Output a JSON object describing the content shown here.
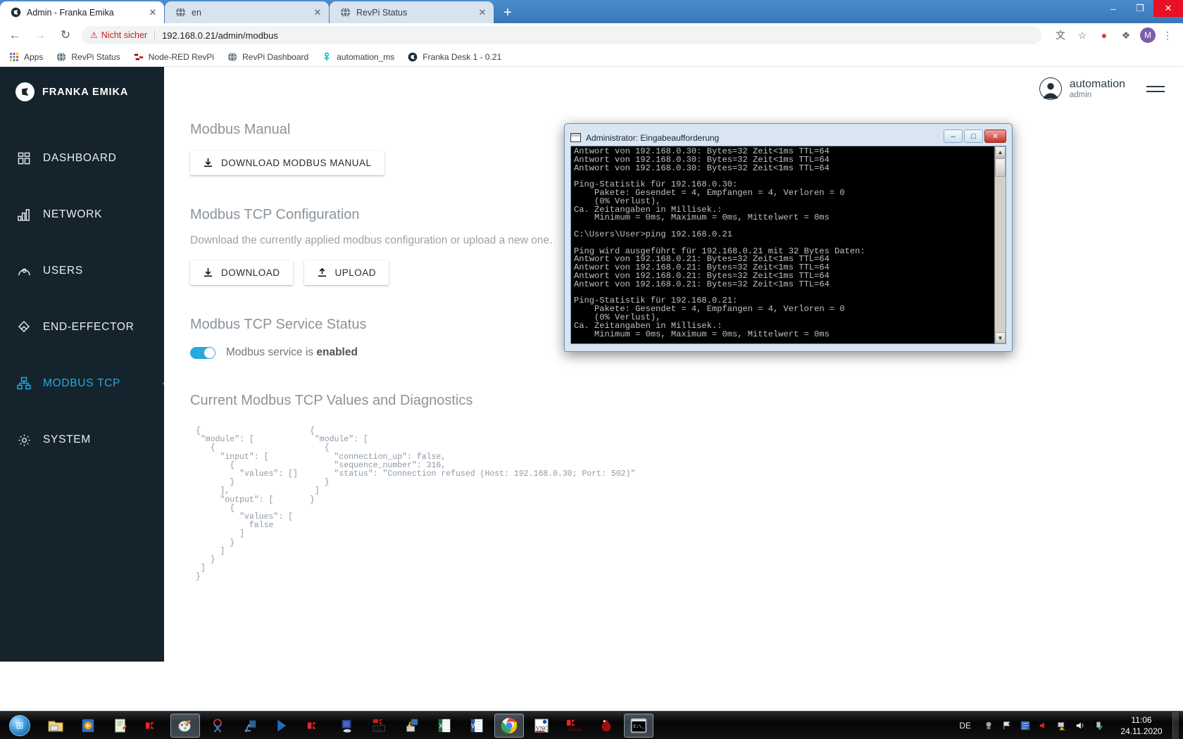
{
  "browser": {
    "tabs": [
      {
        "title": "Admin - Franka Emika",
        "favicon": "franka-icon",
        "close": "✕",
        "active": true
      },
      {
        "title": "en",
        "favicon": "globe-icon",
        "close": "✕",
        "active": false
      },
      {
        "title": "RevPi Status",
        "favicon": "globe-icon",
        "close": "✕",
        "active": false
      }
    ],
    "new_tab_label": "+",
    "window_controls": {
      "minimize": "–",
      "maximize": "❐",
      "close": "✕"
    },
    "nav": {
      "back": "←",
      "forward": "→",
      "reload": "↻"
    },
    "omnibox": {
      "warning_icon": "⚠",
      "warning_text": "Nicht sicher",
      "url": "192.168.0.21/admin/modbus"
    },
    "toolbar_icons": [
      {
        "name": "translate-icon",
        "glyph": "文"
      },
      {
        "name": "bookmark-star-icon",
        "glyph": "☆"
      },
      {
        "name": "adblock-icon",
        "glyph": "●"
      },
      {
        "name": "extensions-puzzle-icon",
        "glyph": "❖"
      }
    ],
    "profile_initial": "M",
    "menu_icon": "⋮",
    "bookmarks": [
      {
        "label": "Apps",
        "icon": "apps-grid-icon"
      },
      {
        "label": "RevPi Status",
        "icon": "globe-icon"
      },
      {
        "label": "Node-RED RevPi",
        "icon": "nodered-icon"
      },
      {
        "label": "RevPi Dashboard",
        "icon": "globe-icon"
      },
      {
        "label": "automation_ms",
        "icon": "nodered-link-icon"
      },
      {
        "label": "Franka Desk 1 - 0.21",
        "icon": "franka-icon"
      }
    ]
  },
  "app": {
    "brand": "FRANKA EMIKA",
    "sidebar": {
      "items": [
        {
          "label": "DASHBOARD",
          "icon": "dashboard-grid-icon",
          "active": false
        },
        {
          "label": "NETWORK",
          "icon": "network-bars-icon",
          "active": false
        },
        {
          "label": "USERS",
          "icon": "users-icon",
          "active": false
        },
        {
          "label": "END-EFFECTOR",
          "icon": "end-effector-icon",
          "active": false
        },
        {
          "label": "MODBUS TCP",
          "icon": "modbus-nodes-icon",
          "active": true
        },
        {
          "label": "SYSTEM",
          "icon": "gear-icon",
          "active": false
        }
      ]
    },
    "header": {
      "user_name": "automation",
      "user_role": "admin",
      "avatar_icon": "user-avatar-icon",
      "menu_icon": "hamburger-icon"
    },
    "sections": {
      "manual": {
        "title": "Modbus Manual",
        "download_button": "DOWNLOAD MODBUS MANUAL",
        "download_icon": "download-arrow-icon"
      },
      "configuration": {
        "title": "Modbus TCP Configuration",
        "description": "Download the currently applied modbus configuration or upload a new one.",
        "download_button": "DOWNLOAD",
        "download_icon": "download-arrow-icon",
        "upload_button": "UPLOAD",
        "upload_icon": "upload-arrow-icon"
      },
      "service_status": {
        "title": "Modbus TCP Service Status",
        "toggle_state": "on",
        "label_prefix": "Modbus service is ",
        "label_state": "enabled",
        "accent_color": "#29a8e0"
      },
      "diagnostics": {
        "title": "Current Modbus TCP Values and Diagnostics",
        "json_left": "{\n \"module\": [\n   {\n     \"input\": [\n       {\n         \"values\": []\n       }\n     ],\n     \"output\": [\n       {\n         \"values\": [\n           false\n         ]\n       }\n     ]\n   }\n ]\n}",
        "json_right": "{\n \"module\": [\n   {\n     \"connection_up\": false,\n     \"sequence_number\": 316,\n     \"status\": \"Connection refused (Host: 192.168.0.30; Port: 502)\"\n   }\n ]\n}"
      }
    }
  },
  "cmd_window": {
    "title": "Administrator: Eingabeaufforderung",
    "icon": "console-icon",
    "buttons": {
      "minimize": "–",
      "maximize": "□",
      "close": "✕"
    },
    "scrollbar": {
      "up": "▲",
      "down": "▼"
    },
    "text": "Antwort von 192.168.0.30: Bytes=32 Zeit<1ms TTL=64\nAntwort von 192.168.0.30: Bytes=32 Zeit<1ms TTL=64\nAntwort von 192.168.0.30: Bytes=32 Zeit<1ms TTL=64\n\nPing-Statistik für 192.168.0.30:\n    Pakete: Gesendet = 4, Empfangen = 4, Verloren = 0\n    (0% Verlust),\nCa. Zeitangaben in Millisek.:\n    Minimum = 0ms, Maximum = 0ms, Mittelwert = 0ms\n\nC:\\Users\\User>ping 192.168.0.21\n\nPing wird ausgeführt für 192.168.0.21 mit 32 Bytes Daten:\nAntwort von 192.168.0.21: Bytes=32 Zeit<1ms TTL=64\nAntwort von 192.168.0.21: Bytes=32 Zeit<1ms TTL=64\nAntwort von 192.168.0.21: Bytes=32 Zeit<1ms TTL=64\nAntwort von 192.168.0.21: Bytes=32 Zeit<1ms TTL=64\n\nPing-Statistik für 192.168.0.21:\n    Pakete: Gesendet = 4, Empfangen = 4, Verloren = 0\n    (0% Verlust),\nCa. Zeitangaben in Millisek.:\n    Minimum = 0ms, Maximum = 0ms, Mittelwert = 0ms\n\nC:\\Users\\User>_"
  },
  "taskbar": {
    "start_glyph": "⊞",
    "items": [
      {
        "name": "explorer-icon",
        "glyph": "🗂",
        "active": false
      },
      {
        "name": "media-player-icon",
        "glyph": "▶",
        "active": false
      },
      {
        "name": "notepad-icon",
        "glyph": "📝",
        "active": false
      },
      {
        "name": "keyence-icon",
        "glyph": "◀",
        "active": false
      },
      {
        "name": "paint-icon",
        "glyph": "🎨",
        "active": true
      },
      {
        "name": "snipping-tool-icon",
        "glyph": "✂",
        "active": false
      },
      {
        "name": "robot-studio-icon",
        "glyph": "🤖",
        "active": false
      },
      {
        "name": "keyence-blue-icon",
        "glyph": "◤",
        "active": false
      },
      {
        "name": "keyence-red-icon",
        "glyph": "◀",
        "active": false
      },
      {
        "name": "remote-desktop-icon",
        "glyph": "🖥",
        "active": false
      },
      {
        "name": "ide-icon",
        "glyph": "▣",
        "active": false
      },
      {
        "name": "device-config-icon",
        "glyph": "⚡",
        "active": false
      },
      {
        "name": "excel-icon",
        "glyph": "X",
        "active": false
      },
      {
        "name": "word-icon",
        "glyph": "W",
        "active": false
      },
      {
        "name": "chrome-icon",
        "glyph": "●",
        "active": true
      },
      {
        "name": "vnc-viewer-icon",
        "glyph": "V",
        "active": false
      },
      {
        "name": "keyence-as-icon",
        "glyph": "◀",
        "active": false
      },
      {
        "name": "inkscape-icon",
        "glyph": "✿",
        "active": false
      },
      {
        "name": "command-prompt-icon",
        "glyph": "C:\\_",
        "active": true
      }
    ],
    "tray": {
      "language": "DE",
      "icons": [
        {
          "name": "webcam-tray-icon",
          "glyph": "◉"
        },
        {
          "name": "flag-action-center-icon",
          "glyph": "⚑"
        },
        {
          "name": "app-tray-icon",
          "glyph": "▦"
        },
        {
          "name": "mute-speaker-icon",
          "glyph": "🔇"
        },
        {
          "name": "network-warning-icon",
          "glyph": "⚠"
        },
        {
          "name": "volume-icon",
          "glyph": "🔈"
        },
        {
          "name": "usb-safe-remove-icon",
          "glyph": "✔"
        }
      ],
      "time": "11:06",
      "date": "24.11.2020"
    }
  }
}
